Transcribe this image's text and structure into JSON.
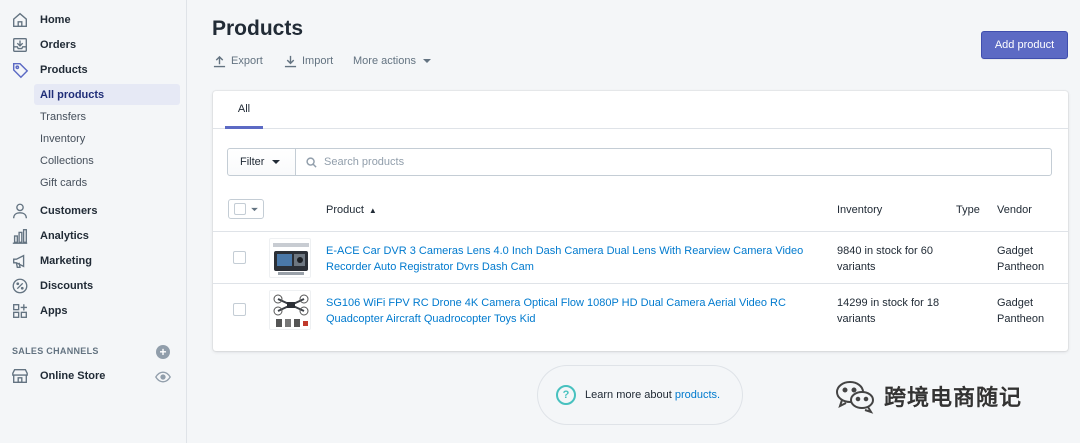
{
  "sidebar": {
    "nav": [
      {
        "label": "Home",
        "icon": "home-icon"
      },
      {
        "label": "Orders",
        "icon": "orders-icon"
      },
      {
        "label": "Products",
        "icon": "tag-icon"
      },
      {
        "label": "Customers",
        "icon": "person-icon"
      },
      {
        "label": "Analytics",
        "icon": "bar-chart-icon"
      },
      {
        "label": "Marketing",
        "icon": "megaphone-icon"
      },
      {
        "label": "Discounts",
        "icon": "discount-icon"
      },
      {
        "label": "Apps",
        "icon": "apps-icon"
      }
    ],
    "products_sub": [
      "All products",
      "Transfers",
      "Inventory",
      "Collections",
      "Gift cards"
    ],
    "active_sub": "All products",
    "sales_channels_title": "SALES CHANNELS",
    "online_store_label": "Online Store"
  },
  "header": {
    "title": "Products",
    "export_label": "Export",
    "import_label": "Import",
    "more_actions_label": "More actions",
    "add_product_label": "Add product"
  },
  "tabs": [
    "All"
  ],
  "filter": {
    "filter_label": "Filter",
    "search_placeholder": "Search products"
  },
  "table": {
    "columns": {
      "product": "Product",
      "inventory": "Inventory",
      "type": "Type",
      "vendor": "Vendor"
    },
    "sort_indicator": "▲",
    "rows": [
      {
        "name": "E-ACE Car DVR 3 Cameras Lens 4.0 Inch Dash Camera Dual Lens With Rearview Camera Video Recorder Auto Registrator Dvrs Dash Cam",
        "inventory": "9840 in stock for 60 variants",
        "type": "",
        "vendor": "Gadget Pantheon"
      },
      {
        "name": "SG106 WiFi FPV RC Drone 4K Camera Optical Flow 1080P HD Dual Camera Aerial Video RC Quadcopter Aircraft Quadrocopter Toys Kid",
        "inventory": "14299 in stock for 18 variants",
        "type": "",
        "vendor": "Gadget Pantheon"
      }
    ]
  },
  "learn_more": {
    "text": "Learn more about",
    "link": "products."
  },
  "watermark": {
    "text": "跨境电商随记"
  },
  "colors": {
    "accent": "#5c6ac4",
    "link": "#007ace",
    "active_bg": "#e6e9f5",
    "help_icon": "#47c1bf"
  }
}
